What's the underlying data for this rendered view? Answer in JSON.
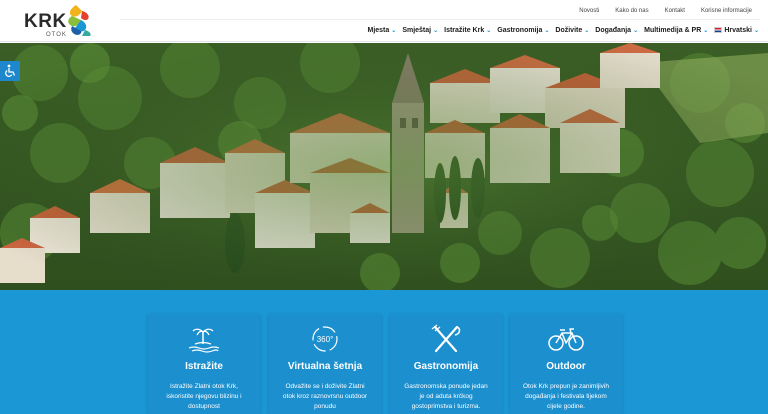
{
  "brand": {
    "name": "KRK",
    "subtitle": "OTOK"
  },
  "utility_links": [
    "Novosti",
    "Kako do nas",
    "Kontakt",
    "Korisne informacije"
  ],
  "main_nav": [
    {
      "label": "Mjesta"
    },
    {
      "label": "Smještaj"
    },
    {
      "label": "Istražite Krk"
    },
    {
      "label": "Gastronomija"
    },
    {
      "label": "Doživite"
    },
    {
      "label": "Događanja"
    },
    {
      "label": "Multimedija & PR"
    }
  ],
  "language": {
    "label": "Hrvatski"
  },
  "icons": {
    "accessibility": "wheelchair-icon",
    "chevron": "chevron-down-icon"
  },
  "cards": [
    {
      "title": "Istražite",
      "icon": "palm-island-icon",
      "desc_lines": [
        "Istražite Zlatni otok Krk,",
        "iskoristite njegovu blizinu i",
        "dostupnost"
      ]
    },
    {
      "title": "Virtualna šetnja",
      "icon": "360-view-icon",
      "icon_text": "360°",
      "desc_lines": [
        "Odvažite se i doživite  Zlatni",
        "otok kroz raznovrsnu outdoor",
        "ponudu"
      ]
    },
    {
      "title": "Gastronomija",
      "icon": "fork-knife-icon",
      "desc_lines": [
        "Gastronomska ponude jedan",
        "je od aduta krčkog",
        "gostoprimstva i turizma."
      ]
    },
    {
      "title": "Outdoor",
      "icon": "bicycle-icon",
      "desc_lines": [
        "Otok Krk prepun je zanimljivih",
        "događanja i festivala tijekom",
        "cijele godine."
      ]
    }
  ],
  "colors": {
    "accent_blue": "#1b97d6",
    "card_blue": "#1c8fce",
    "nav_chevron": "#1b90cf",
    "accessibility_blue": "#1f88cc"
  }
}
